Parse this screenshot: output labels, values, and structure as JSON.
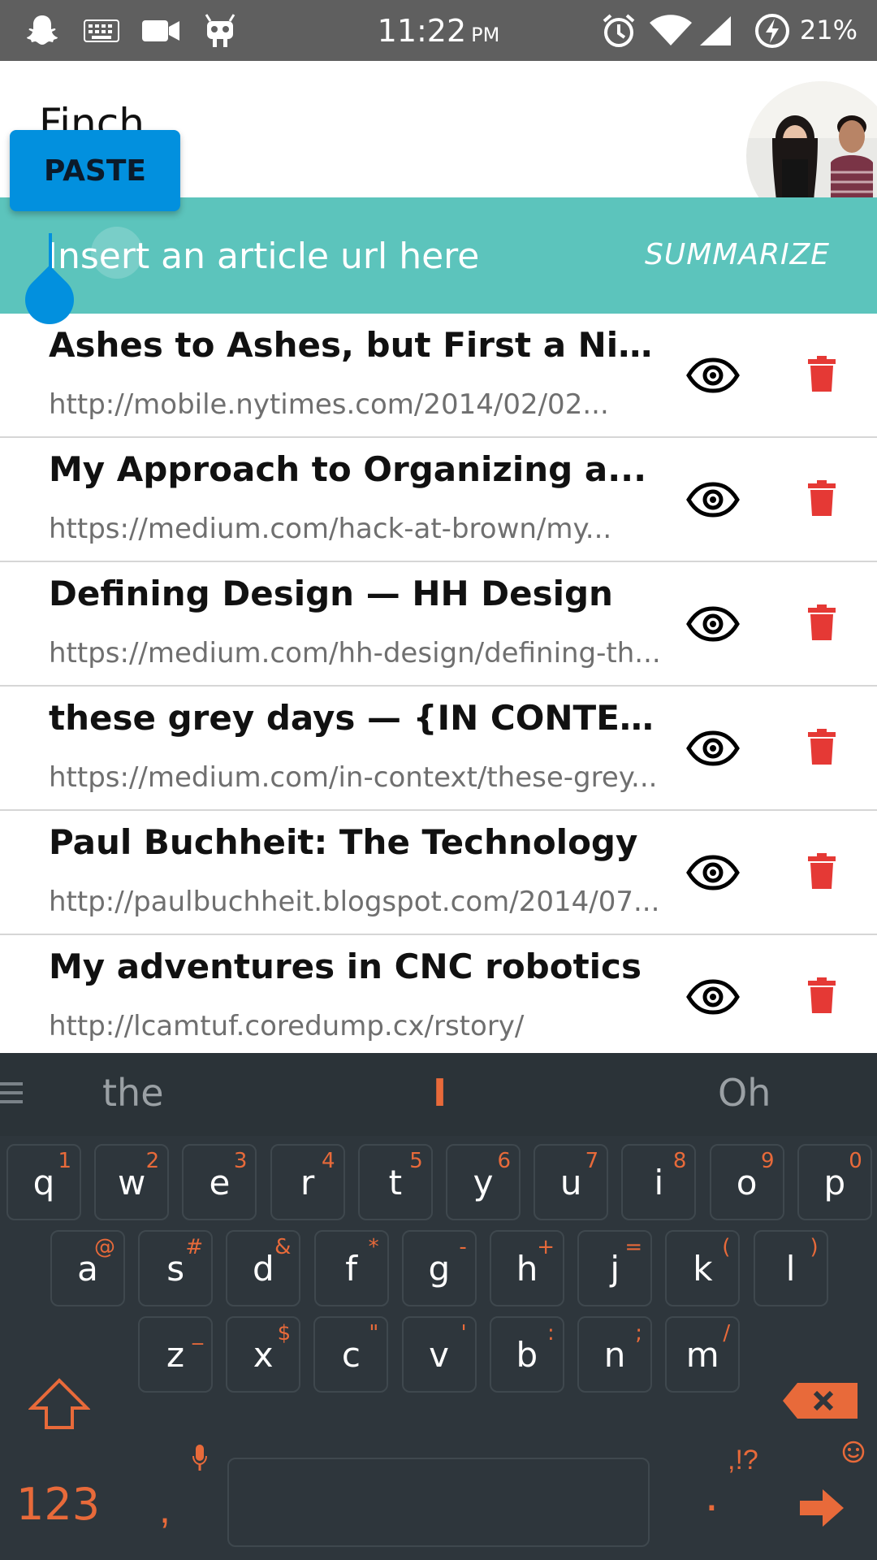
{
  "status_bar": {
    "time": "11:22",
    "ampm": "PM",
    "battery": "21%",
    "icons": [
      "snapchat-icon",
      "keyboard-icon",
      "video-camera-icon",
      "android-icon",
      "alarm-icon",
      "wifi-icon",
      "signal-icon",
      "battery-charging-icon"
    ]
  },
  "app": {
    "title": "Finch",
    "accent_color": "#5cc4bc",
    "paste_label": "PASTE",
    "url_placeholder": "Insert an article url here",
    "summarize_label": "SUMMARIZE"
  },
  "articles": [
    {
      "title": "Ashes to Ashes, but First a Nice Pin...",
      "url": "http://mobile.nytimes.com/2014/02/02..."
    },
    {
      "title": "My Approach to Organizing a...",
      "url": "https://medium.com/hack-at-brown/my..."
    },
    {
      "title": "Defining Design — HH Design",
      "url": "https://medium.com/hh-design/defining-th..."
    },
    {
      "title": "these grey days — {IN CONTEXT}",
      "url": "https://medium.com/in-context/these-grey..."
    },
    {
      "title": "Paul Buchheit: The Technology",
      "url": "http://paulbuchheit.blogspot.com/2014/07..."
    },
    {
      "title": "My adventures in CNC robotics",
      "url": "http://lcamtuf.coredump.cx/rstory/"
    }
  ],
  "keyboard": {
    "suggestions": [
      "the",
      "I",
      "Oh"
    ],
    "row1": [
      {
        "key": "q",
        "alt": "1"
      },
      {
        "key": "w",
        "alt": "2"
      },
      {
        "key": "e",
        "alt": "3"
      },
      {
        "key": "r",
        "alt": "4"
      },
      {
        "key": "t",
        "alt": "5"
      },
      {
        "key": "y",
        "alt": "6"
      },
      {
        "key": "u",
        "alt": "7"
      },
      {
        "key": "i",
        "alt": "8"
      },
      {
        "key": "o",
        "alt": "9"
      },
      {
        "key": "p",
        "alt": "0"
      }
    ],
    "row2": [
      {
        "key": "a",
        "alt": "@"
      },
      {
        "key": "s",
        "alt": "#"
      },
      {
        "key": "d",
        "alt": "&"
      },
      {
        "key": "f",
        "alt": "*"
      },
      {
        "key": "g",
        "alt": "-"
      },
      {
        "key": "h",
        "alt": "+"
      },
      {
        "key": "j",
        "alt": "="
      },
      {
        "key": "k",
        "alt": "("
      },
      {
        "key": "l",
        "alt": ")"
      }
    ],
    "row3": [
      {
        "key": "z",
        "alt": "_"
      },
      {
        "key": "x",
        "alt": "$"
      },
      {
        "key": "c",
        "alt": "\""
      },
      {
        "key": "v",
        "alt": "'"
      },
      {
        "key": "b",
        "alt": ":"
      },
      {
        "key": "n",
        "alt": ";"
      },
      {
        "key": "m",
        "alt": "/"
      }
    ],
    "mode_label": "123",
    "comma_label": ",",
    "punct_label": ",!?",
    "period_label": ".",
    "accent_color": "#e86a3a"
  }
}
